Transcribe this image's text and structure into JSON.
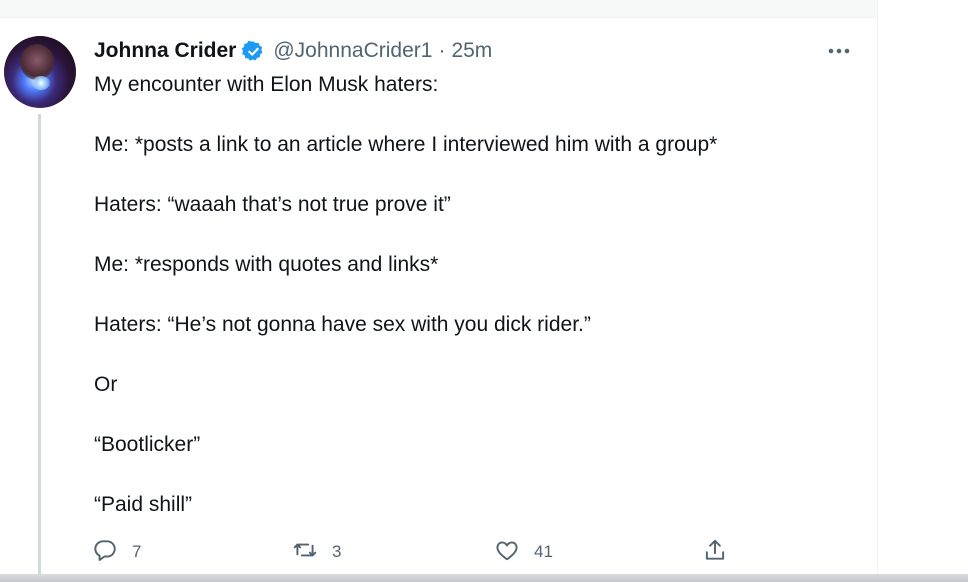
{
  "tweet": {
    "display_name": "Johnna Crider",
    "handle": "@JohnnaCrider1",
    "separator": "·",
    "time": "25m",
    "lines": [
      "My encounter with Elon Musk haters:",
      "Me: *posts a link to an article where I interviewed him with a group*",
      "Haters: “waaah that’s not true prove it”",
      "Me: *responds with quotes and links*",
      "Haters: “He’s not gonna have sex with you dick rider.”",
      "Or",
      "“Bootlicker”",
      "“Paid shill”"
    ]
  },
  "actions": {
    "reply_count": "7",
    "retweet_count": "3",
    "like_count": "41"
  },
  "icons": {
    "verified": "verified-badge-icon",
    "more": "more-options-icon",
    "reply": "reply-icon",
    "retweet": "retweet-icon",
    "like": "like-icon",
    "share": "share-icon"
  },
  "colors": {
    "accent": "#1d9bf0",
    "text": "#0f1419",
    "secondary": "#536471",
    "thread_line": "#cfd9de"
  }
}
